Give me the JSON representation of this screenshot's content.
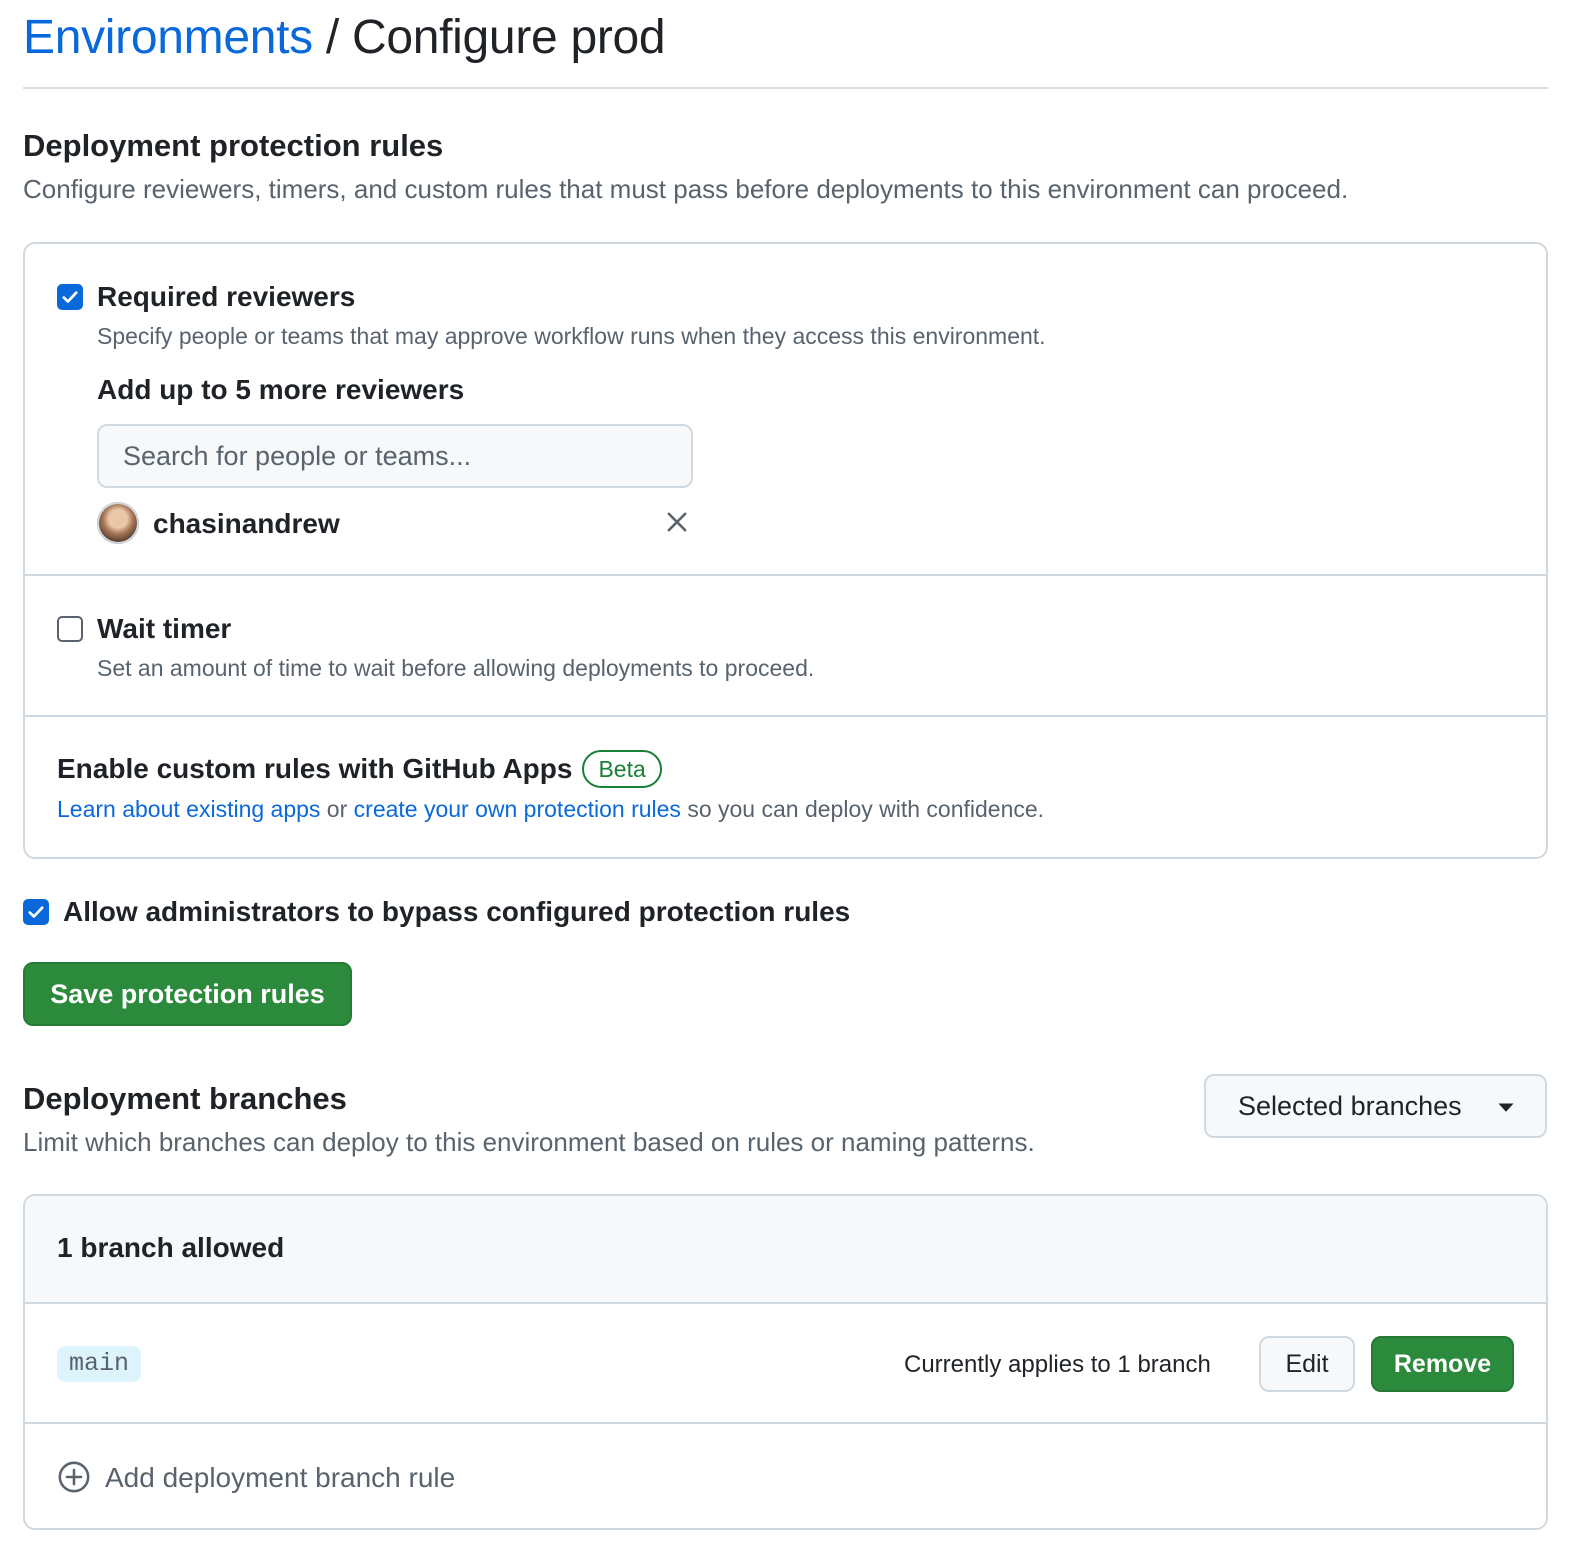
{
  "breadcrumb": {
    "parent": "Environments",
    "separator": " / ",
    "current": "Configure prod"
  },
  "protection": {
    "title": "Deployment protection rules",
    "description": "Configure reviewers, timers, and custom rules that must pass before deployments to this environment can proceed.",
    "required_reviewers": {
      "checked": true,
      "label": "Required reviewers",
      "description": "Specify people or teams that may approve workflow runs when they access this environment.",
      "add_label": "Add up to 5 more reviewers",
      "search_placeholder": "Search for people or teams...",
      "reviewers": [
        {
          "name": "chasinandrew"
        }
      ]
    },
    "wait_timer": {
      "checked": false,
      "label": "Wait timer",
      "description": "Set an amount of time to wait before allowing deployments to proceed."
    },
    "custom_rules": {
      "label": "Enable custom rules with GitHub Apps",
      "badge": "Beta",
      "link1": "Learn about existing apps",
      "or_text": " or ",
      "link2": "create your own protection rules",
      "suffix": " so you can deploy with confidence."
    },
    "admin_bypass": {
      "checked": true,
      "label": "Allow administrators to bypass configured protection rules"
    },
    "save_label": "Save protection rules"
  },
  "branches": {
    "title": "Deployment branches",
    "description": "Limit which branches can deploy to this environment based on rules or naming patterns.",
    "dropdown_value": "Selected branches",
    "count_label": "1 branch allowed",
    "rules": [
      {
        "pattern": "main",
        "applies": "Currently applies to 1 branch",
        "edit_label": "Edit",
        "remove_label": "Remove"
      }
    ],
    "add_label": "Add deployment branch rule"
  },
  "colors": {
    "link": "#0969da",
    "primary_button": "#2c8a3d",
    "badge_green": "#1a7f37",
    "checkbox_accent": "#0969da"
  },
  "icons": {
    "check": "check-icon",
    "close": "close-icon",
    "dropdown": "triangle-down-icon",
    "add": "plus-circle-icon"
  }
}
